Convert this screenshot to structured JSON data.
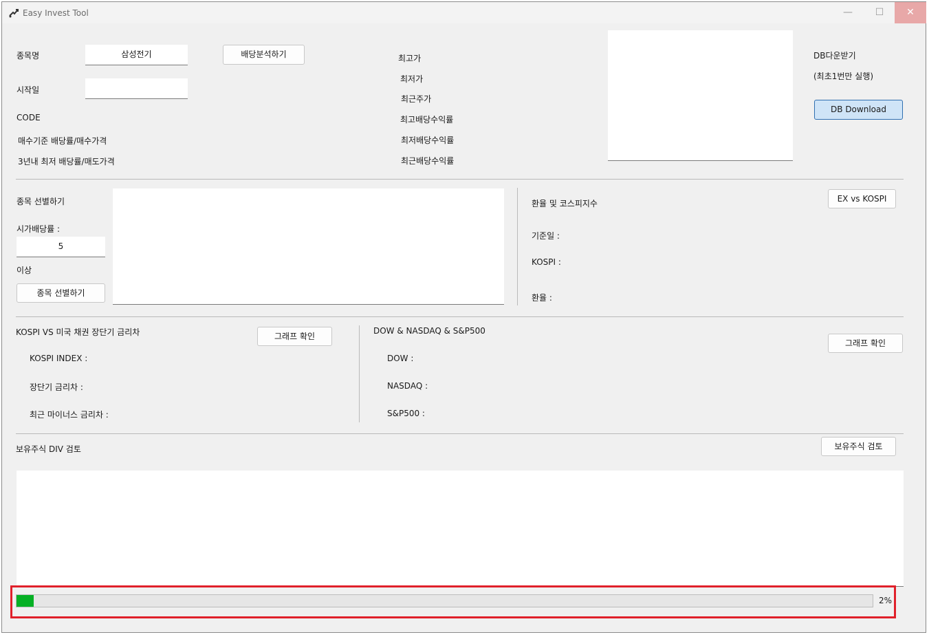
{
  "window": {
    "title": "Easy Invest Tool",
    "controls": {
      "minimize": "—",
      "maximize": "☐",
      "close": "✕"
    }
  },
  "stock": {
    "name_label": "종목명",
    "name_value": "삼성전기",
    "dividend_button": "배당분석하기",
    "start_label": "시작일",
    "start_value": "",
    "code_label": "CODE",
    "buy_basis_label": "매수기준 배당률/매수가격",
    "three_year_label": "3년내 최저 배당률/매도가격",
    "max_price_label": "최고가",
    "min_price_label": "최저가",
    "recent_price_label": "최근주가",
    "max_yield_label": "최고배당수익률",
    "min_yield_label": "최저배당수익률",
    "recent_yield_label": "최근배당수익률"
  },
  "db": {
    "title": "DB다운받기",
    "note": "(최초1번만 실행)",
    "download_button": "DB Download"
  },
  "screening": {
    "title": "종목 선별하기",
    "yield_label": "시가배당률 :",
    "yield_value": "5",
    "above_label": "이상",
    "run_button": "종목 선별하기"
  },
  "exchange": {
    "title": "환율 및 코스피지수",
    "graph_button": "EX vs KOSPI",
    "base_date_label": "기준일 :",
    "kospi_label": "KOSPI :",
    "rate_label": "환율 :"
  },
  "bond": {
    "title": "KOSPI VS 미국 채권 장단기 금리차",
    "graph_button": "그래프 확인",
    "kospi_index_label": "KOSPI INDEX :",
    "spread_label": "장단기 금리차 :",
    "neg_spread_label": "최근 마이너스 금리차 :"
  },
  "us_index": {
    "title": "DOW & NASDAQ & S&P500",
    "graph_button": "그래프 확인",
    "dow_label": "DOW :",
    "nasdaq_label": "NASDAQ :",
    "sp500_label": "S&P500 :"
  },
  "holdings": {
    "title": "보유주식 DIV 검토",
    "review_button": "보유주식 검토"
  },
  "progress": {
    "value": 0.02,
    "label": "2%",
    "fill_color": "#06b025"
  }
}
